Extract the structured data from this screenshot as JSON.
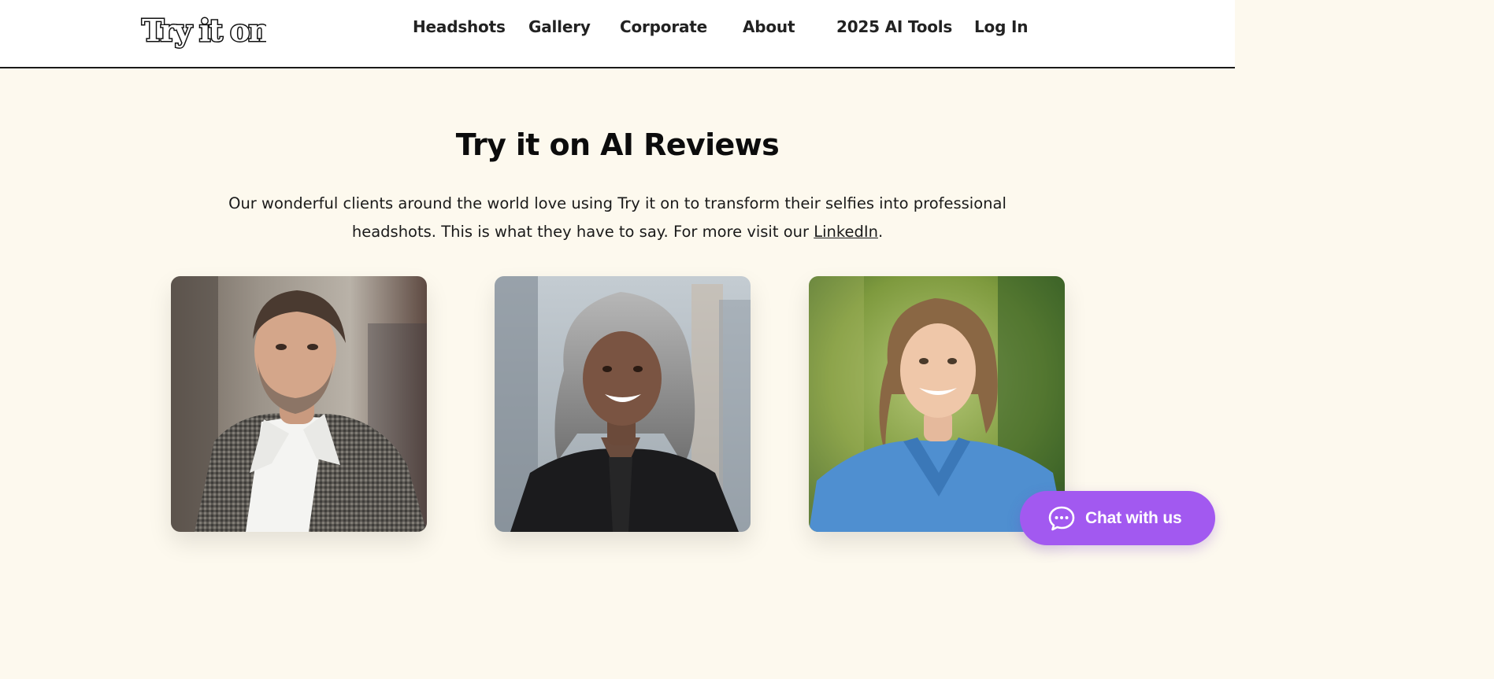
{
  "header": {
    "logo_text": "Try it on",
    "nav": [
      {
        "label": "Headshots"
      },
      {
        "label": "Gallery"
      },
      {
        "label": "Corporate"
      },
      {
        "label": "About"
      },
      {
        "label": "2025 AI Tools"
      },
      {
        "label": "Log In"
      }
    ]
  },
  "main": {
    "heading": "Try it on AI Reviews",
    "intro_before": "Our wonderful clients around the world love using Try it on to transform their selfies into professional headshots. This is what they have to say. For more visit our ",
    "intro_link": "LinkedIn",
    "intro_after": "."
  },
  "reviews": {
    "photos": [
      {
        "subject": "man-headshot-photo"
      },
      {
        "subject": "woman-headshot-photo"
      },
      {
        "subject": "nurse-headshot-photo"
      }
    ]
  },
  "chat_widget": {
    "label": "Chat with us",
    "icon": "chat-bubble-icon",
    "color": "#a259f0"
  },
  "colors": {
    "page_background": "#fdf9ee",
    "header_background": "#ffffff",
    "accent": "#a259f0"
  }
}
